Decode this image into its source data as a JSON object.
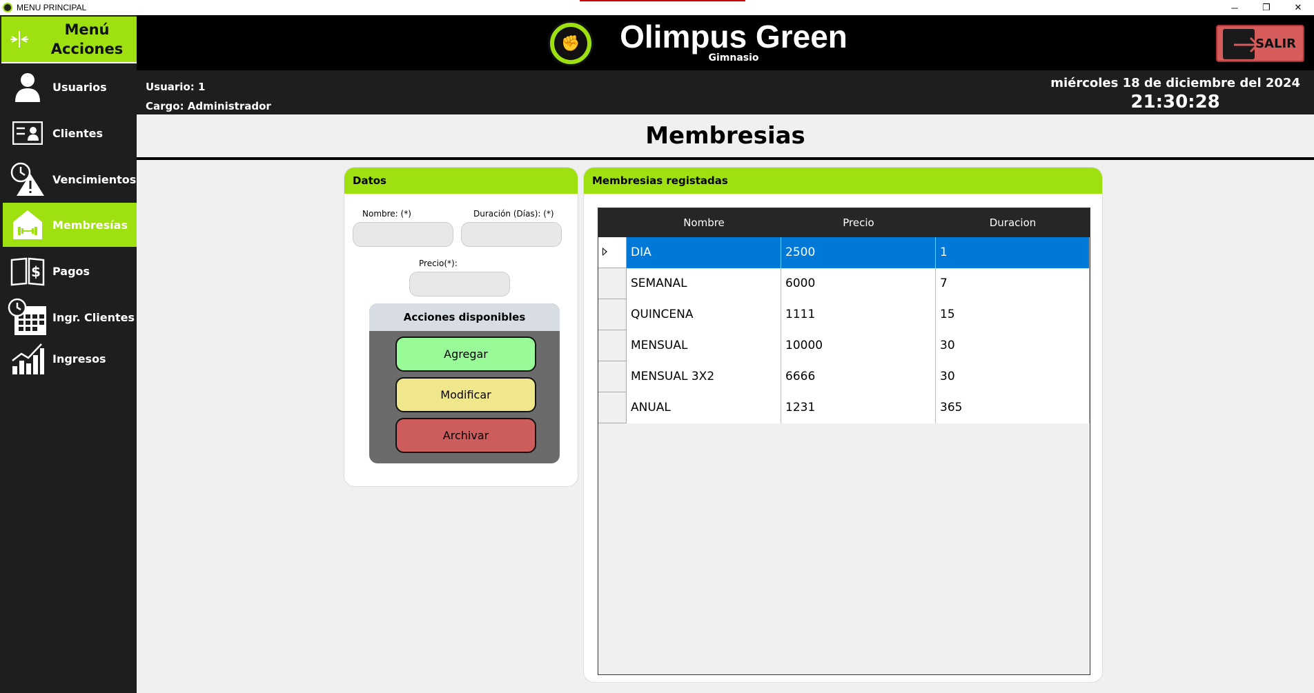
{
  "window": {
    "title": "MENU PRINCIPAL",
    "minimize": "─",
    "restore": "❐",
    "close": "✕"
  },
  "sidebar": {
    "header_label": "Menú Acciones",
    "items": [
      {
        "label": "Usuarios",
        "icon": "user-icon"
      },
      {
        "label": "Clientes",
        "icon": "id-card-icon"
      },
      {
        "label": "Vencimientos",
        "icon": "clock-warning-icon"
      },
      {
        "label": "Membresías",
        "icon": "house-dumbbell-icon"
      },
      {
        "label": "Pagos",
        "icon": "dollar-book-icon"
      },
      {
        "label": "Ingr. Clientes",
        "icon": "calendar-clock-icon"
      },
      {
        "label": "Ingresos",
        "icon": "chart-bars-icon"
      }
    ],
    "active_index": 3
  },
  "header": {
    "brand_name": "Olimpus Green",
    "brand_sub": "Gimnasio",
    "exit_label": "SALIR",
    "accent": "#9fe011"
  },
  "info": {
    "user": "Usuario: 1",
    "role": "Cargo: Administrador",
    "date": "miércoles 18 de diciembre del 2024",
    "time": "21:30:28"
  },
  "page": {
    "title": "Membresias"
  },
  "datos": {
    "header": "Datos",
    "nombre_label": "Nombre: (*)",
    "duracion_label": "Duración (Días): (*)",
    "precio_label": "Precio(*):",
    "nombre_value": "",
    "duracion_value": "",
    "precio_value": "",
    "actions_header": "Acciones disponibles",
    "add_label": "Agregar",
    "modify_label": "Modificar",
    "archive_label": "Archivar"
  },
  "membresias": {
    "header": "Membresias registadas",
    "columns": [
      "Nombre",
      "Precio",
      "Duracion"
    ],
    "rows": [
      {
        "nombre": "DIA",
        "precio": "2500",
        "duracion": "1"
      },
      {
        "nombre": "SEMANAL",
        "precio": "6000",
        "duracion": "7"
      },
      {
        "nombre": "QUINCENA",
        "precio": "1111",
        "duracion": "15"
      },
      {
        "nombre": "MENSUAL",
        "precio": "10000",
        "duracion": "30"
      },
      {
        "nombre": "MENSUAL 3X2",
        "precio": "6666",
        "duracion": "30"
      },
      {
        "nombre": "ANUAL",
        "precio": "1231",
        "duracion": "365"
      }
    ],
    "selected_index": 0
  }
}
